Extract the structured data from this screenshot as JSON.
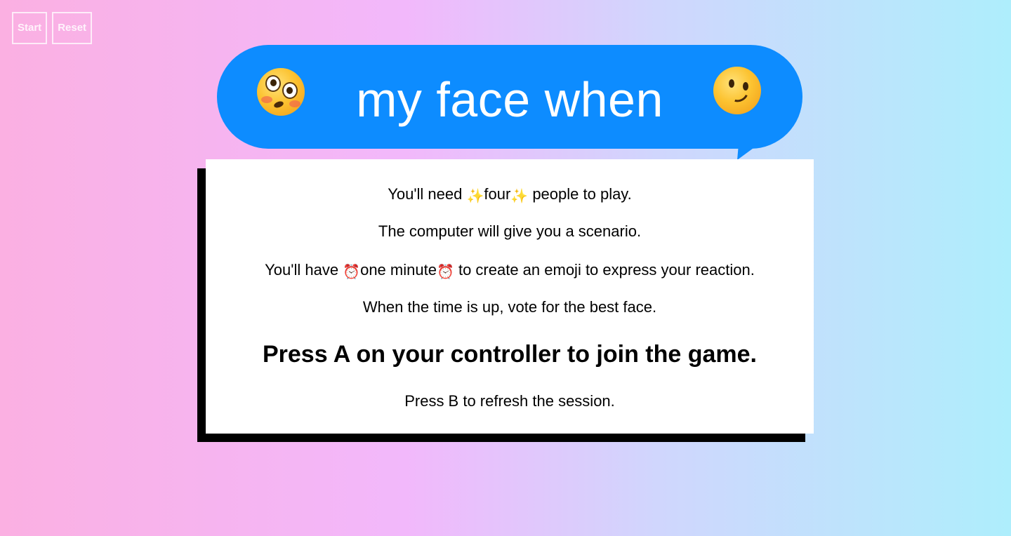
{
  "controls": {
    "start_label": "Start",
    "reset_label": "Reset"
  },
  "header": {
    "title": "my face when",
    "left_emoji": "flushed-face",
    "right_emoji": "winking-smiling-face",
    "bubble_color": "#0d8cff"
  },
  "instructions": {
    "line1_pre": "You'll need ",
    "line1_emoji": "✨",
    "line1_highlight": "four",
    "line1_post": " people to play.",
    "line2": "The computer will give you a scenario.",
    "line3_pre": "You'll have ",
    "line3_emoji": "⏰",
    "line3_highlight": "one minute",
    "line3_post": " to create an emoji to express your reaction.",
    "line4": "When the time is up, vote for the best face.",
    "line5": "Press A on your controller to join the game.",
    "line6": "Press B to refresh the session."
  },
  "colors": {
    "background_left": "#fbb0e2",
    "background_right": "#aeeefc",
    "card": "#ffffff",
    "card_shadow": "#000000"
  }
}
